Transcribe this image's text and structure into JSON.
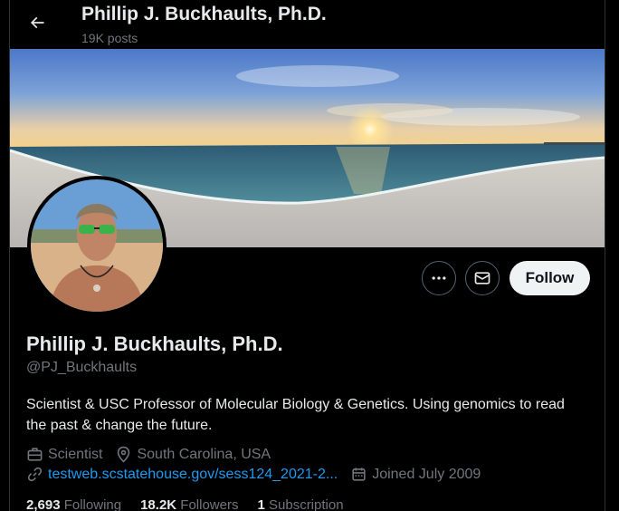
{
  "header": {
    "name": "Phillip J. Buckhaults, Ph.D.",
    "posts": "19K posts"
  },
  "profile": {
    "display_name": "Phillip J. Buckhaults, Ph.D.",
    "handle": "@PJ_Buckhaults",
    "bio": "Scientist & USC Professor of Molecular Biology & Genetics. Using genomics to read the past & change the future.",
    "category": "Scientist",
    "location": "South Carolina, USA",
    "website": "testweb.scstatehouse.gov/sess124_2021-2...",
    "joined": "Joined July 2009"
  },
  "actions": {
    "more_icon": "more-dots-icon",
    "message_icon": "envelope-icon",
    "follow_label": "Follow"
  },
  "stats": {
    "following_count": "2,693",
    "following_label": "Following",
    "followers_count": "18.2K",
    "followers_label": "Followers",
    "subscriptions_count": "1",
    "subscriptions_label": "Subscription"
  },
  "colors": {
    "background": "#000000",
    "text": "#e7e9ea",
    "muted": "#71767b",
    "link": "#1d9bf0",
    "follow_button": "#eff3f4"
  }
}
